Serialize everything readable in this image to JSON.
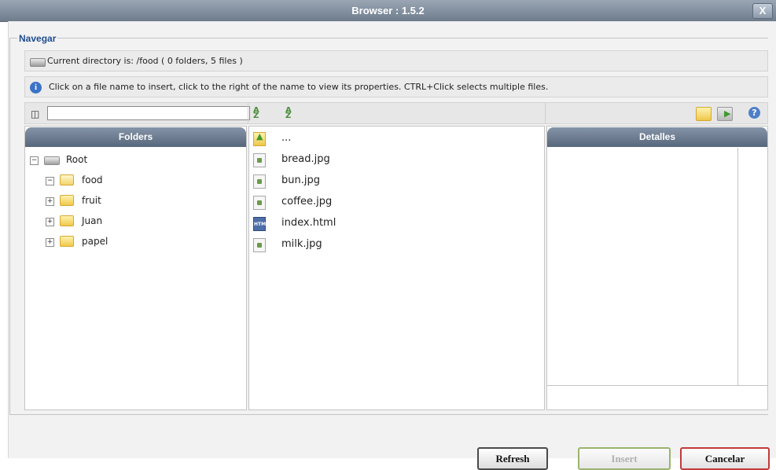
{
  "window": {
    "title": "Browser : 1.5.2",
    "close_label": "X"
  },
  "section": {
    "legend": "Navegar"
  },
  "status": {
    "current_directory": "Current directory is: /food ( 0 folders, 5 files )"
  },
  "help": {
    "info_text": "Click on a file name to insert, click to the right of the name to view its properties. CTRL+Click selects multiple files."
  },
  "toolbar": {
    "search_value": "",
    "search_icon": "binoculars-icon",
    "sort_icons": [
      "sort-ascending-icon",
      "sort-descending-icon"
    ],
    "right_icons": [
      "new-folder-icon",
      "move-icon",
      "help-icon"
    ]
  },
  "folders_panel": {
    "title": "Folders"
  },
  "tree": [
    {
      "label": "Root",
      "expander": "−",
      "icon": "drive"
    },
    {
      "label": "food",
      "expander": "−",
      "icon": "folder-open"
    },
    {
      "label": "fruit",
      "expander": "+",
      "icon": "folder"
    },
    {
      "label": "Juan",
      "expander": "+",
      "icon": "folder"
    },
    {
      "label": "papel",
      "expander": "+",
      "icon": "folder"
    }
  ],
  "files": [
    {
      "name": "...",
      "icon": "up-folder"
    },
    {
      "name": "bread.jpg",
      "icon": "image"
    },
    {
      "name": "bun.jpg",
      "icon": "image"
    },
    {
      "name": "coffee.jpg",
      "icon": "image"
    },
    {
      "name": "index.html",
      "icon": "html"
    },
    {
      "name": "milk.jpg",
      "icon": "image"
    }
  ],
  "details_panel": {
    "title": "Detalles"
  },
  "buttons": {
    "refresh": "Refresh",
    "insert": "Insert",
    "cancel": "Cancelar"
  }
}
